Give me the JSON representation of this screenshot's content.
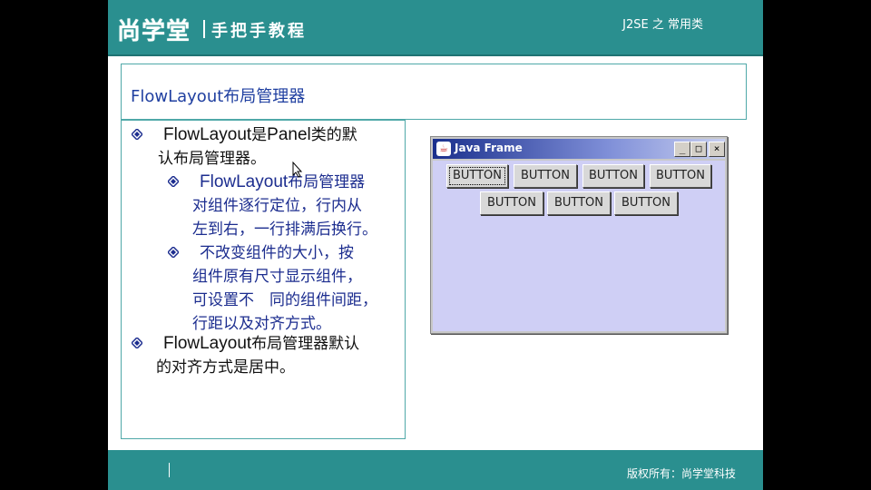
{
  "header": {
    "logo": "尚学堂",
    "tagline": "手把手教程",
    "course": "J2SE 之 常用类"
  },
  "title": "FlowLayout布局管理器",
  "bullets": {
    "b1": {
      "lead": "FlowLayout",
      "rest1": "是",
      "lead2": "Panel",
      "rest2": "类的默",
      "line2": "认布局管理器。"
    },
    "b2": {
      "lead": "FlowLayout",
      "rest1": "布局管理器",
      "line2": "对组件逐行定位，行内从",
      "line3": "左到右，一行排满后换行。"
    },
    "b2b": {
      "line1": "不改变组件的大小，按",
      "line2": "组件原有尺寸显示组件，",
      "line3": "可设置不　同的组件间距，",
      "line4": "行距以及对齐方式。"
    },
    "b3": {
      "lead": "FlowLayout",
      "rest1": "布局管理器默认",
      "line2": "的对齐方式是居中。"
    }
  },
  "java_frame": {
    "title": "Java Frame",
    "icon": "java-coffee-icon",
    "buttons": [
      "BUTTON",
      "BUTTON",
      "BUTTON",
      "BUTTON",
      "BUTTON",
      "BUTTON",
      "BUTTON"
    ],
    "minimize": "_",
    "maximize": "□",
    "close": "×"
  },
  "footer": {
    "copyright": "版权所有：尚学堂科技"
  },
  "colors": {
    "header_bg": "#2a8f8f",
    "title_blue": "#1f3fa0",
    "bullet_blue": "#1c2d8f",
    "frame_bg": "#cfcff5"
  }
}
